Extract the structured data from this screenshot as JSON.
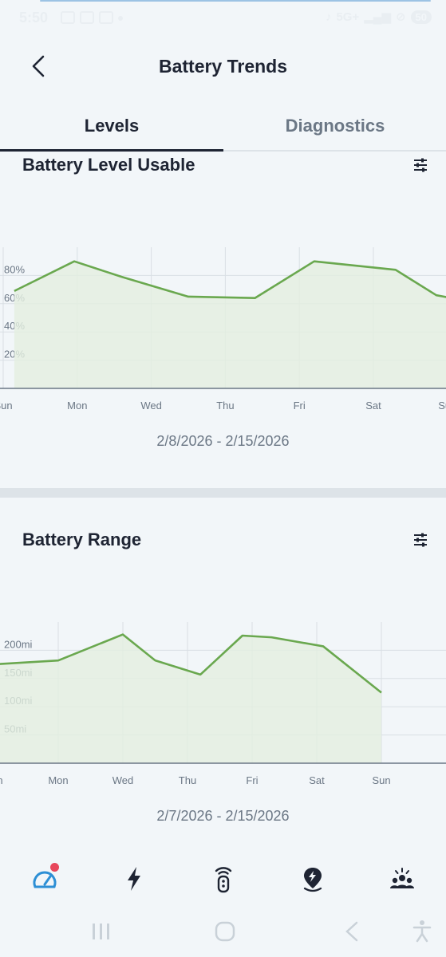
{
  "status_bar": {
    "time": "5:50",
    "network": "5G+",
    "battery": "50"
  },
  "header": {
    "title": "Battery Trends",
    "back_icon": "chevron-left-icon"
  },
  "tabs": [
    {
      "label": "Levels",
      "active": true
    },
    {
      "label": "Diagnostics",
      "active": false
    }
  ],
  "level_section": {
    "title": "Battery Level Usable",
    "filter_icon": "sliders-icon",
    "date_range": "2/8/2026 - 2/15/2026"
  },
  "range_section": {
    "title": "Battery Range",
    "filter_icon": "sliders-icon",
    "date_range": "2/7/2026 - 2/15/2026"
  },
  "chart_data": [
    {
      "type": "area",
      "title": "Battery Level Usable",
      "xlabel": "",
      "ylabel": "",
      "x_ticks": [
        "Sun",
        "Mon",
        "Wed",
        "Thu",
        "Fri",
        "Sat",
        "Sun"
      ],
      "y_ticks": [
        "20%",
        "40%",
        "60%",
        "80%"
      ],
      "ylim": [
        0,
        100
      ],
      "grid": true,
      "x": [
        0.15,
        0.96,
        1.6,
        2.5,
        3.4,
        4.2,
        5.3,
        5.85,
        7.0
      ],
      "values": [
        69,
        90,
        79,
        65,
        64,
        90,
        84,
        66,
        55
      ],
      "color": "#6aa84f",
      "fill": "#e3efe0"
    },
    {
      "type": "area",
      "title": "Battery Range",
      "xlabel": "",
      "ylabel": "",
      "x_ticks": [
        "Sun",
        "Mon",
        "Wed",
        "Thu",
        "Fri",
        "Sat",
        "Sun"
      ],
      "y_ticks": [
        "50mi",
        "100mi",
        "150mi",
        "200mi"
      ],
      "ylim": [
        0,
        250
      ],
      "grid": true,
      "x": [
        0,
        1.0,
        2.0,
        2.5,
        3.2,
        3.85,
        4.3,
        5.1,
        6.0
      ],
      "values": [
        175,
        182,
        228,
        182,
        157,
        226,
        223,
        207,
        125
      ],
      "color": "#6aa84f",
      "fill": "#e3efe0"
    }
  ],
  "bottom_nav": [
    {
      "icon": "gauge-icon",
      "active": true,
      "badge": true
    },
    {
      "icon": "lightning-icon",
      "active": false,
      "badge": false
    },
    {
      "icon": "remote-key-icon",
      "active": false,
      "badge": false
    },
    {
      "icon": "map-pin-charge-icon",
      "active": false,
      "badge": false
    },
    {
      "icon": "community-icon",
      "active": false,
      "badge": false
    }
  ]
}
